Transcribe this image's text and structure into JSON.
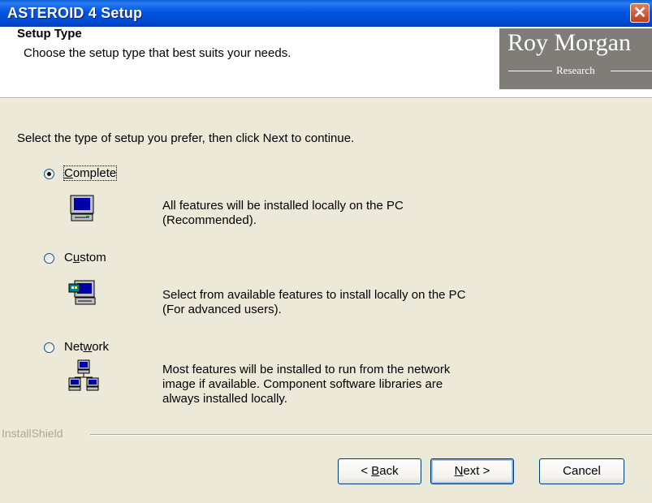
{
  "window": {
    "title": "ASTEROID 4 Setup",
    "close_glyph": "✕"
  },
  "header": {
    "title": "Setup Type",
    "subtitle": "Choose the setup type that best suits your needs.",
    "logo": {
      "name": "Roy Morgan",
      "sub": "Research"
    }
  },
  "intro": "Select the type of setup you prefer, then click Next to continue.",
  "options": [
    {
      "label_pre": "",
      "label_key": "C",
      "label_post": "omplete",
      "selected": true,
      "icon": "computer-icon",
      "desc": [
        "All features will be installed locally on the PC",
        "(Recommended)."
      ]
    },
    {
      "label_pre": "C",
      "label_key": "u",
      "label_post": "stom",
      "selected": false,
      "icon": "custom-computer-icon",
      "desc": [
        "Select from available features to install locally on the PC",
        "(For advanced users)."
      ]
    },
    {
      "label_pre": "Net",
      "label_key": "w",
      "label_post": "ork",
      "selected": false,
      "icon": "network-icon",
      "desc": [
        "Most features will be installed to run from the network",
        "image if available.  Component software libraries are",
        "always installed locally."
      ]
    }
  ],
  "footer": {
    "brand": "InstallShield"
  },
  "buttons": {
    "back": {
      "pre": "< ",
      "key": "B",
      "post": "ack"
    },
    "next": {
      "pre": "",
      "key": "N",
      "post": "ext >"
    },
    "cancel": "Cancel"
  },
  "colors": {
    "titlebar": "#0054e3",
    "dialog": "#ECE9D8",
    "logo_bg": "#807d78"
  }
}
